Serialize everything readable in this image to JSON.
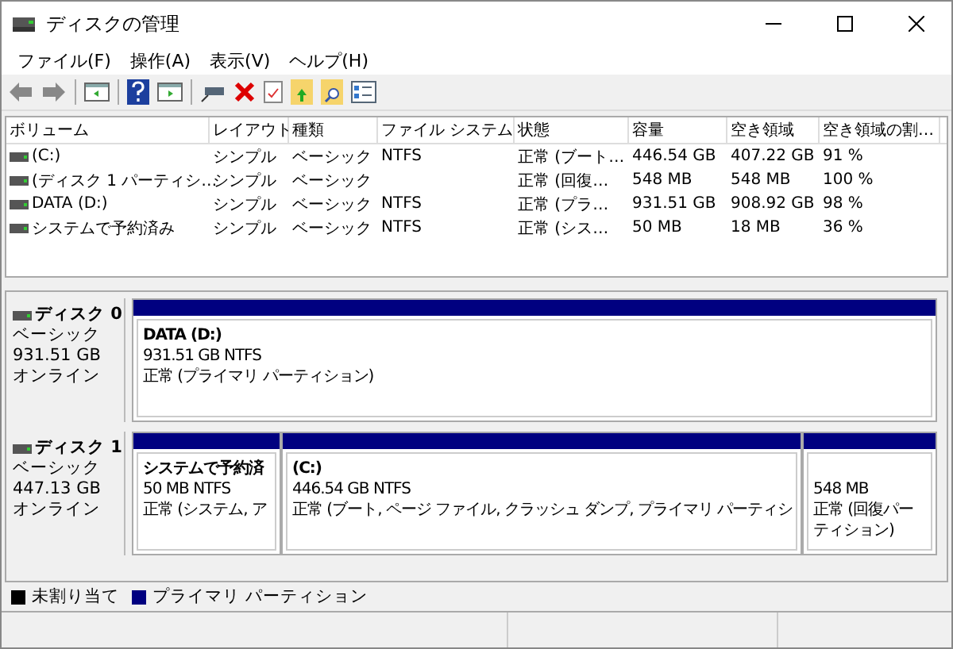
{
  "window": {
    "title": "ディスクの管理"
  },
  "menu": [
    "ファイル(F)",
    "操作(A)",
    "表示(V)",
    "ヘルプ(H)"
  ],
  "volume_table": {
    "columns": [
      "ボリューム",
      "レイアウト",
      "種類",
      "ファイル システム",
      "状態",
      "容量",
      "空き領域",
      "空き領域の割…"
    ],
    "rows": [
      {
        "cells": [
          " (C:)",
          "シンプル",
          "ベーシック",
          "NTFS",
          "正常 (ブート…",
          "446.54 GB",
          "407.22 GB",
          "91 %"
        ]
      },
      {
        "cells": [
          "(ディスク 1 パーティシ…",
          "シンプル",
          "ベーシック",
          "",
          "正常 (回復…",
          "548 MB",
          "548 MB",
          "100 %"
        ]
      },
      {
        "cells": [
          "DATA (D:)",
          "シンプル",
          "ベーシック",
          "NTFS",
          "正常 (プラ…",
          "931.51 GB",
          "908.92 GB",
          "98 %"
        ]
      },
      {
        "cells": [
          "システムで予約済み",
          "シンプル",
          "ベーシック",
          "NTFS",
          "正常 (シス…",
          "50 MB",
          "18 MB",
          "36 %"
        ]
      }
    ]
  },
  "disks": [
    {
      "name": "ディスク 0",
      "type": "ベーシック",
      "size": "931.51 GB",
      "status": "オンライン",
      "partitions": [
        {
          "name": "DATA  (D:)",
          "detail": "931.51 GB NTFS",
          "status": "正常 (プライマリ パーティション)"
        }
      ]
    },
    {
      "name": "ディスク 1",
      "type": "ベーシック",
      "size": "447.13 GB",
      "status": "オンライン",
      "partitions": [
        {
          "name": "システムで予約済",
          "detail": "50 MB NTFS",
          "status": "正常 (システム, ア"
        },
        {
          "name": " (C:)",
          "detail": "446.54 GB NTFS",
          "status": "正常 (ブート, ページ ファイル, クラッシュ ダンプ, プライマリ パーティシ"
        },
        {
          "detail": "548 MB",
          "status": "正常 (回復パーティション)"
        }
      ]
    }
  ],
  "legend": [
    {
      "label": "未割り当て",
      "color": "#000000"
    },
    {
      "label": "プライマリ パーティション",
      "color": "#000080"
    }
  ]
}
